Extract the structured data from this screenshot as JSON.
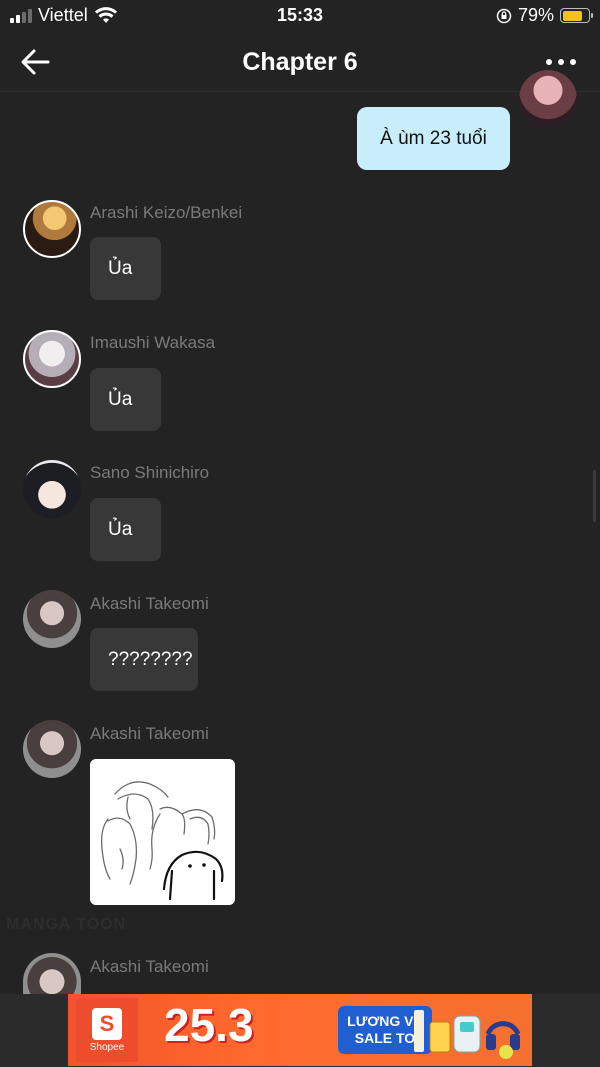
{
  "status_bar": {
    "carrier": "Viettel",
    "time": "15:33",
    "battery_percent": "79%",
    "battery_level": 0.79,
    "signal_bars_active": 2,
    "battery_color": "#f3c21a"
  },
  "header": {
    "title": "Chapter 6",
    "back_icon": "arrow-left-icon",
    "more_icon": "more-horizontal-icon"
  },
  "messages": [
    {
      "direction": "outgoing",
      "text": "À ùm 23 tuổi"
    },
    {
      "direction": "incoming",
      "sender": "Arashi Keizo/Benkei",
      "text": "Ủa"
    },
    {
      "direction": "incoming",
      "sender": "Imaushi Wakasa",
      "text": "Ủa"
    },
    {
      "direction": "incoming",
      "sender": "Sano Shinichiro",
      "text": "Ủa"
    },
    {
      "direction": "incoming",
      "sender": "Akashi Takeomi",
      "text": "????????"
    },
    {
      "direction": "incoming",
      "sender": "Akashi Takeomi",
      "type": "sticker"
    },
    {
      "direction": "incoming",
      "sender": "Akashi Takeomi"
    }
  ],
  "watermark": "MANGA TOON",
  "ad": {
    "brand": "Shopee",
    "logo_letter": "S",
    "headline": "25.3",
    "tag_line1": "LƯƠNG VỀ",
    "tag_line2": "SALE TO",
    "bg_color": "#f2532b"
  },
  "colors": {
    "background": "#232323",
    "incoming_bubble": "#383838",
    "outgoing_bubble": "#c8eefc",
    "sender_name": "#7a7a7a"
  }
}
